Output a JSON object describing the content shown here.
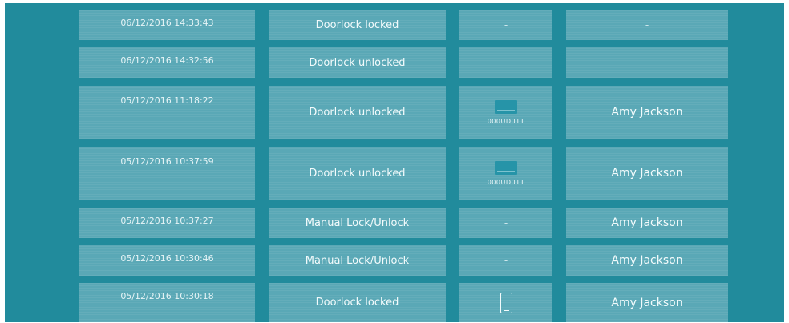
{
  "log": {
    "rows": [
      {
        "datetime": "06/12/2016 14:33:43",
        "event": "Doorlock locked",
        "device": "-",
        "device_type": "none",
        "user": "-"
      },
      {
        "datetime": "06/12/2016 14:32:56",
        "event": "Doorlock unlocked",
        "device": "-",
        "device_type": "none",
        "user": "-"
      },
      {
        "datetime": "05/12/2016 11:18:22",
        "event": "Doorlock unlocked",
        "device": "000UD011",
        "device_type": "card-icon",
        "user": "Amy Jackson"
      },
      {
        "datetime": "05/12/2016 10:37:59",
        "event": "Doorlock unlocked",
        "device": "000UD011",
        "device_type": "card-icon",
        "user": "Amy Jackson"
      },
      {
        "datetime": "05/12/2016 10:37:27",
        "event": "Manual Lock/Unlock",
        "device": "-",
        "device_type": "none",
        "user": "Amy Jackson"
      },
      {
        "datetime": "05/12/2016 10:30:46",
        "event": "Manual Lock/Unlock",
        "device": "-",
        "device_type": "none",
        "user": "Amy Jackson"
      },
      {
        "datetime": "05/12/2016 10:30:18",
        "event": "Doorlock locked",
        "device": "",
        "device_type": "phone-icon",
        "user": "Amy Jackson"
      }
    ]
  },
  "colors": {
    "background": "#218b9c",
    "cell": "#5aa8b6",
    "text": "#f3fbfc"
  }
}
